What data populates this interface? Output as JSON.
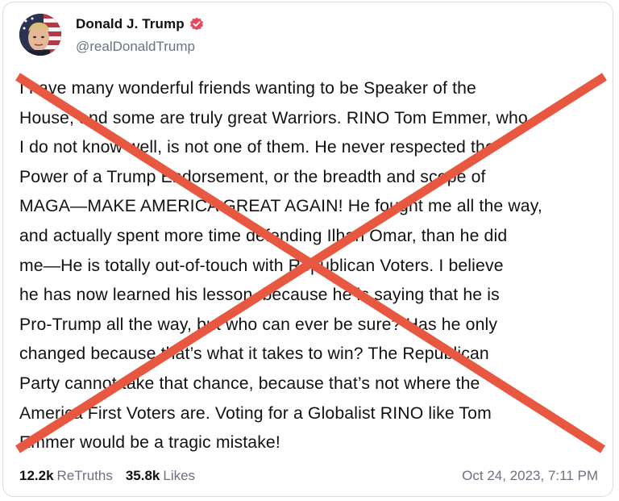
{
  "author": {
    "display_name": "Donald J. Trump",
    "handle": "@realDonaldTrump",
    "verified": true,
    "verified_color": "#e8455f"
  },
  "post": {
    "lines": [
      "I have many wonderful friends wanting to be Speaker of the",
      "House, and some are truly great Warriors. RINO Tom Emmer, who",
      "I do not know well, is not one of them. He never respected the",
      "Power of a Trump Endorsement, or the breadth and scope of",
      "MAGA—MAKE AMERICA GREAT AGAIN! He fought me all the way,",
      "and actually spent more time defending Ilhan Omar, than he did",
      "me—He is totally out-of-touch with Republican Voters. I believe",
      "he has now learned his lesson, because he is saying that he is",
      "Pro-Trump all the way, but who can ever be sure? Has he only",
      "changed because that’s what it takes to win? The Republican",
      "Party cannot take that chance, because that’s not where the",
      "America First Voters are. Voting for a Globalist RINO like Tom",
      "Emmer would be a tragic mistake!"
    ]
  },
  "stats": {
    "retruths_count": "12.2k",
    "retruths_label": "ReTruths",
    "likes_count": "35.8k",
    "likes_label": "Likes"
  },
  "timestamp": "Oct 24, 2023, 7:11 PM",
  "overlay": {
    "cross_color": "#e8573f"
  }
}
